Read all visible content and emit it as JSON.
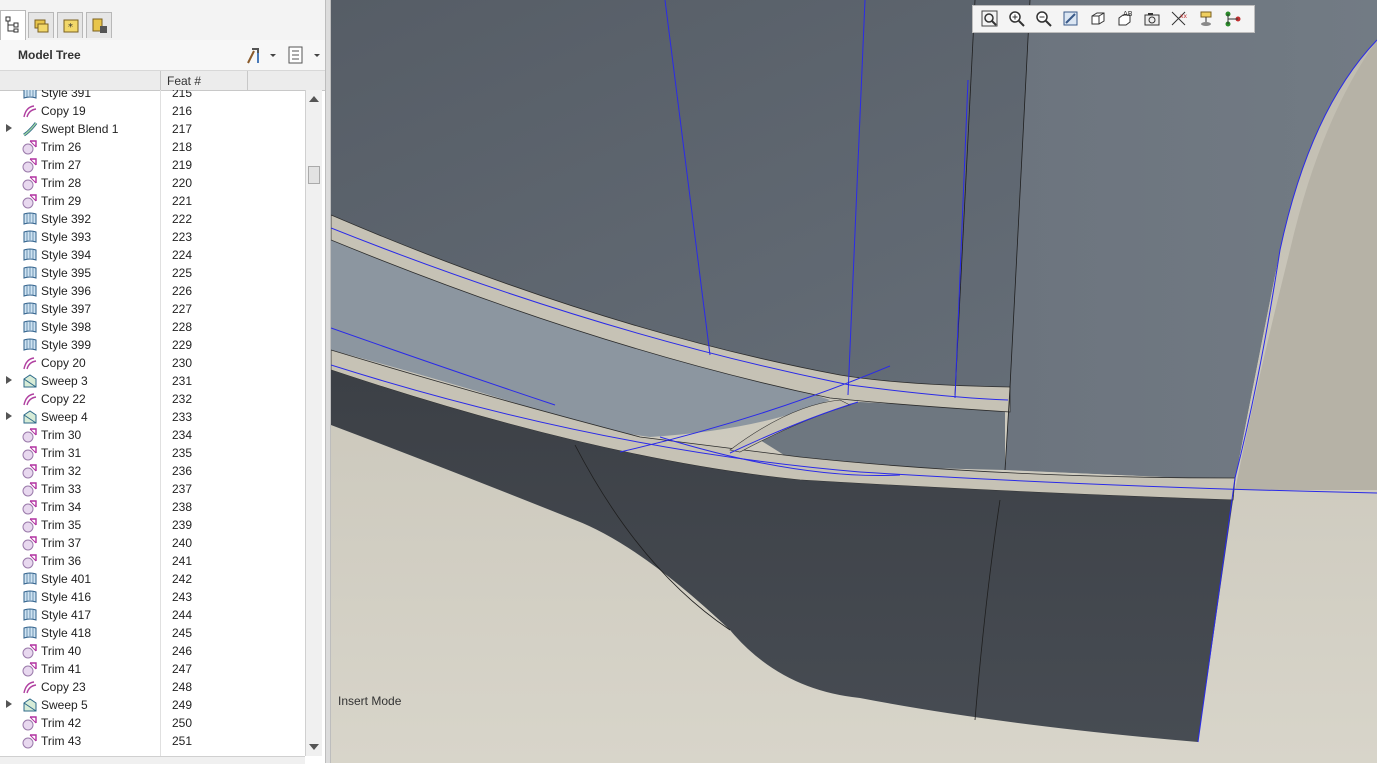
{
  "model_tree": {
    "title": "Model Tree",
    "column_feat": "Feat #",
    "rows": [
      {
        "name": "Style 391",
        "feat": "215",
        "icon": "style",
        "expandable": false
      },
      {
        "name": "Copy 19",
        "feat": "216",
        "icon": "copy",
        "expandable": false
      },
      {
        "name": "Swept Blend 1",
        "feat": "217",
        "icon": "swept-blend",
        "expandable": true
      },
      {
        "name": "Trim 26",
        "feat": "218",
        "icon": "trim",
        "expandable": false
      },
      {
        "name": "Trim 27",
        "feat": "219",
        "icon": "trim",
        "expandable": false
      },
      {
        "name": "Trim 28",
        "feat": "220",
        "icon": "trim",
        "expandable": false
      },
      {
        "name": "Trim 29",
        "feat": "221",
        "icon": "trim",
        "expandable": false
      },
      {
        "name": "Style 392",
        "feat": "222",
        "icon": "style",
        "expandable": false
      },
      {
        "name": "Style 393",
        "feat": "223",
        "icon": "style",
        "expandable": false
      },
      {
        "name": "Style 394",
        "feat": "224",
        "icon": "style",
        "expandable": false
      },
      {
        "name": "Style 395",
        "feat": "225",
        "icon": "style",
        "expandable": false
      },
      {
        "name": "Style 396",
        "feat": "226",
        "icon": "style",
        "expandable": false
      },
      {
        "name": "Style 397",
        "feat": "227",
        "icon": "style",
        "expandable": false
      },
      {
        "name": "Style 398",
        "feat": "228",
        "icon": "style",
        "expandable": false
      },
      {
        "name": "Style 399",
        "feat": "229",
        "icon": "style",
        "expandable": false
      },
      {
        "name": "Copy 20",
        "feat": "230",
        "icon": "copy",
        "expandable": false
      },
      {
        "name": "Sweep 3",
        "feat": "231",
        "icon": "sweep",
        "expandable": true
      },
      {
        "name": "Copy 22",
        "feat": "232",
        "icon": "copy",
        "expandable": false
      },
      {
        "name": "Sweep 4",
        "feat": "233",
        "icon": "sweep",
        "expandable": true
      },
      {
        "name": "Trim 30",
        "feat": "234",
        "icon": "trim",
        "expandable": false
      },
      {
        "name": "Trim 31",
        "feat": "235",
        "icon": "trim",
        "expandable": false
      },
      {
        "name": "Trim 32",
        "feat": "236",
        "icon": "trim",
        "expandable": false
      },
      {
        "name": "Trim 33",
        "feat": "237",
        "icon": "trim",
        "expandable": false
      },
      {
        "name": "Trim 34",
        "feat": "238",
        "icon": "trim",
        "expandable": false
      },
      {
        "name": "Trim 35",
        "feat": "239",
        "icon": "trim",
        "expandable": false
      },
      {
        "name": "Trim 37",
        "feat": "240",
        "icon": "trim",
        "expandable": false
      },
      {
        "name": "Trim 36",
        "feat": "241",
        "icon": "trim",
        "expandable": false
      },
      {
        "name": "Style 401",
        "feat": "242",
        "icon": "style",
        "expandable": false
      },
      {
        "name": "Style 416",
        "feat": "243",
        "icon": "style",
        "expandable": false
      },
      {
        "name": "Style 417",
        "feat": "244",
        "icon": "style",
        "expandable": false
      },
      {
        "name": "Style 418",
        "feat": "245",
        "icon": "style",
        "expandable": false
      },
      {
        "name": "Trim 40",
        "feat": "246",
        "icon": "trim",
        "expandable": false
      },
      {
        "name": "Trim 41",
        "feat": "247",
        "icon": "trim",
        "expandable": false
      },
      {
        "name": "Copy 23",
        "feat": "248",
        "icon": "copy",
        "expandable": false
      },
      {
        "name": "Sweep 5",
        "feat": "249",
        "icon": "sweep",
        "expandable": true
      },
      {
        "name": "Trim 42",
        "feat": "250",
        "icon": "trim",
        "expandable": false
      },
      {
        "name": "Trim 43",
        "feat": "251",
        "icon": "trim",
        "expandable": false
      }
    ]
  },
  "viewport": {
    "status_text": "Insert Mode",
    "toolbar_icons": [
      "refit-icon",
      "zoom-in-icon",
      "zoom-out-icon",
      "repaint-icon",
      "display-style-icon",
      "saved-views-icon",
      "layers-icon",
      "datum-display-icon",
      "annotation-display-icon",
      "spin-center-icon"
    ]
  },
  "colors": {
    "curve_blue": "#2a2ae8",
    "surface_dark": "#4a4f56",
    "surface_mid": "#5f6a75",
    "floor": "#c9c5b8"
  }
}
